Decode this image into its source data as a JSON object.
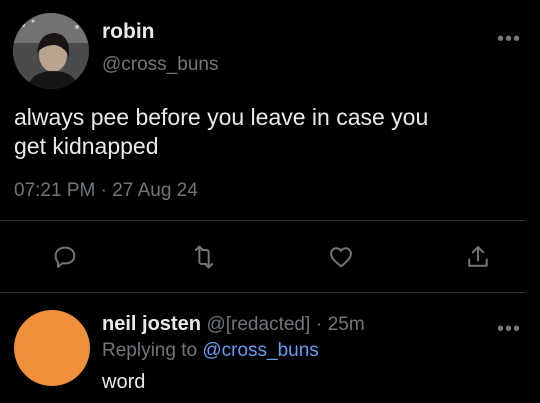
{
  "tweet": {
    "author_name": "robin",
    "author_handle": "@cross_buns",
    "text_line1": "always pee before you leave in case you",
    "text_line2": "get kidnapped",
    "time": "07:21 PM",
    "date_separator": "·",
    "date": "27 Aug 24",
    "more_label": "•••"
  },
  "actions": [
    {
      "icon": "reply-icon"
    },
    {
      "icon": "retweet-icon"
    },
    {
      "icon": "like-icon"
    },
    {
      "icon": "share-icon"
    }
  ],
  "reply": {
    "author_name": "neil josten",
    "author_handle": "@[redacted]",
    "separator": "·",
    "age": "25m",
    "replying_prefix": "Replying to",
    "replying_handle": "@cross_buns",
    "text": "word",
    "more_label": "•••",
    "avatar_color": "#f0903a"
  },
  "colors": {
    "background": "#000000",
    "primary_text": "#e7e9ea",
    "secondary_text": "#71767b",
    "link": "#6b9cf0",
    "divider": "#2f3336"
  }
}
